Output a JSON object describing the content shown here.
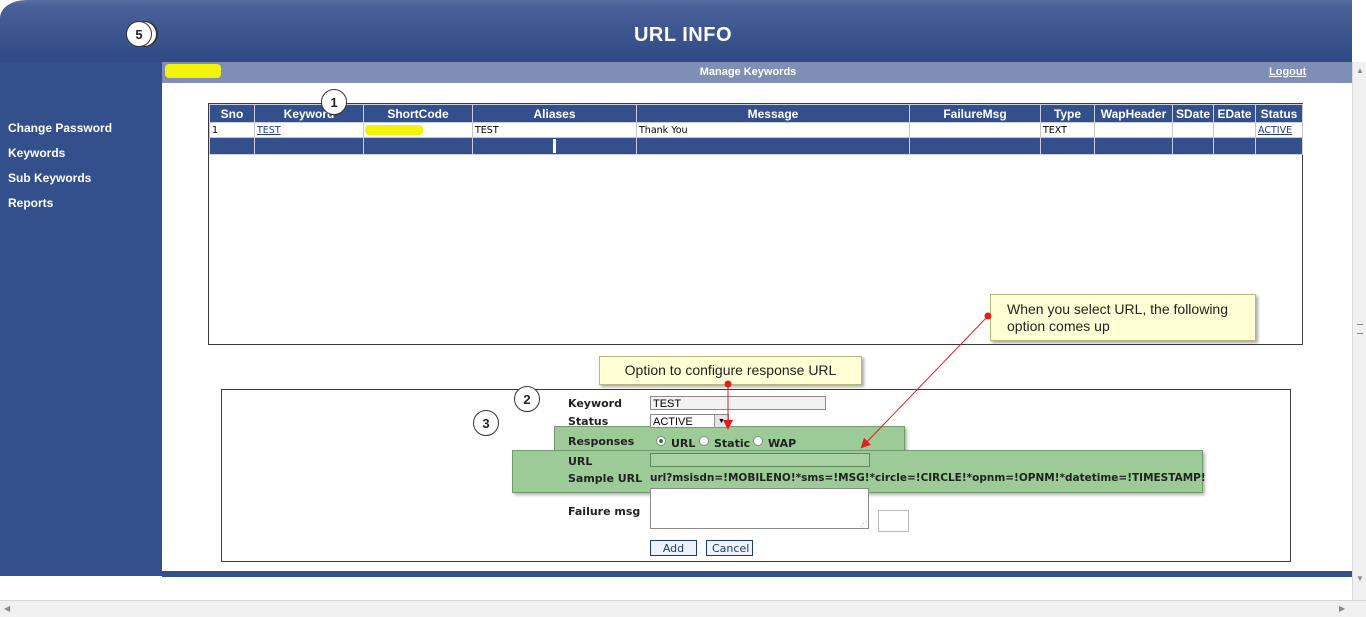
{
  "header": {
    "title": "URL INFO"
  },
  "subbar": {
    "title": "Manage Keywords",
    "logout": "Logout"
  },
  "sidebar": {
    "items": [
      {
        "label": "Change Password"
      },
      {
        "label": "Keywords"
      },
      {
        "label": "Sub Keywords"
      },
      {
        "label": "Reports"
      }
    ]
  },
  "table": {
    "columns": [
      "Sno",
      "Keyword",
      "ShortCode",
      "Aliases",
      "Message",
      "FailureMsg",
      "Type",
      "WapHeader",
      "SDate",
      "EDate",
      "Status"
    ],
    "rows": [
      {
        "sno": "1",
        "keyword": "TEST",
        "shortcode": "",
        "aliases": "TEST",
        "message": "Thank You",
        "failuremsg": "",
        "type": "TEXT",
        "wapheader": "",
        "sdate": "",
        "edate": "",
        "status": "ACTIVE"
      }
    ]
  },
  "form": {
    "keyword_label": "Keyword",
    "keyword_value": "TEST",
    "status_label": "Status",
    "status_value": "ACTIVE",
    "responses_label": "Responses",
    "responses_options": [
      "URL",
      "Static",
      "WAP"
    ],
    "responses_selected": "URL",
    "url_label": "URL",
    "url_value": "",
    "sample_url_label": "Sample URL",
    "sample_url_value": "url?msisdn=!MOBILENO!*sms=!MSG!*circle=!CIRCLE!*opnm=!OPNM!*datetime=!TIMESTAMP!",
    "failure_label": "Failure msg",
    "add_label": "Add",
    "cancel_label": "Cancel"
  },
  "annotations": {
    "callout_url": "When you select URL, the following option comes up",
    "callout_response": "Option to configure response URL",
    "markers": [
      "1",
      "2",
      "3",
      "5"
    ]
  },
  "colors": {
    "header": "#34508c",
    "highlight_green": "#9ccb98",
    "callout_bg": "#ffffd6",
    "arrow_red": "#e02020"
  }
}
